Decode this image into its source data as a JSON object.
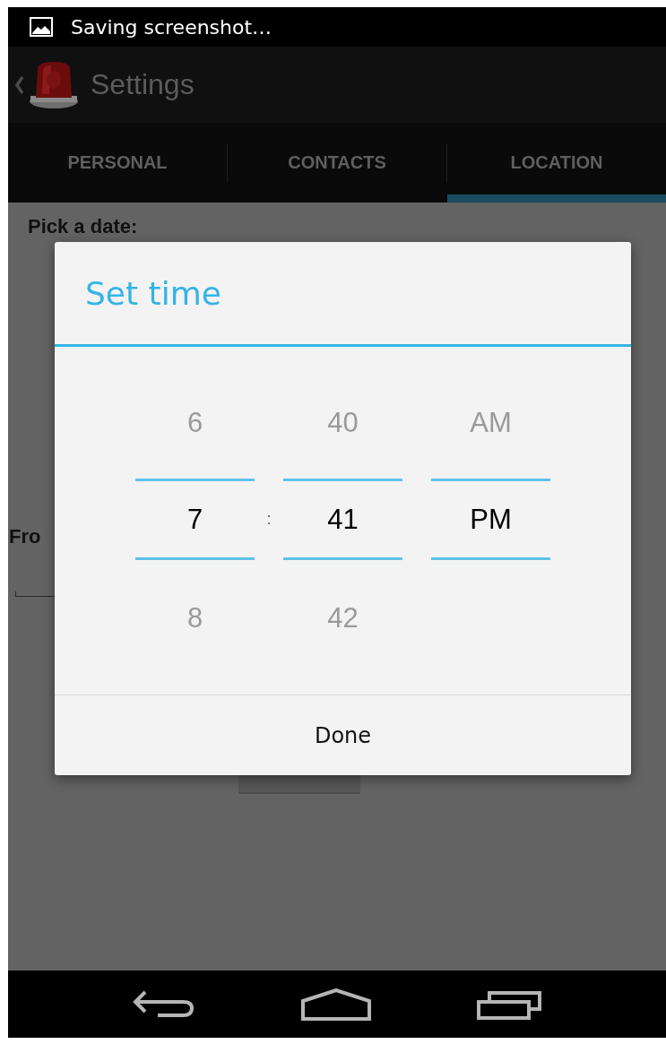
{
  "status_bar": {
    "notification": "Saving screenshot…"
  },
  "action_bar": {
    "title": "Settings"
  },
  "tabs": [
    {
      "label": "PERSONAL",
      "selected": false
    },
    {
      "label": "CONTACTS",
      "selected": false
    },
    {
      "label": "LOCATION",
      "selected": true
    }
  ],
  "content": {
    "date_label": "Pick a date:",
    "from_label": "Fro"
  },
  "dialog": {
    "title": "Set time",
    "separator": ":",
    "columns": [
      {
        "above": "6",
        "value": "7",
        "below": "8"
      },
      {
        "above": "40",
        "value": "41",
        "below": "42"
      },
      {
        "above": "AM",
        "value": "PM"
      }
    ],
    "done_button": "Done"
  }
}
